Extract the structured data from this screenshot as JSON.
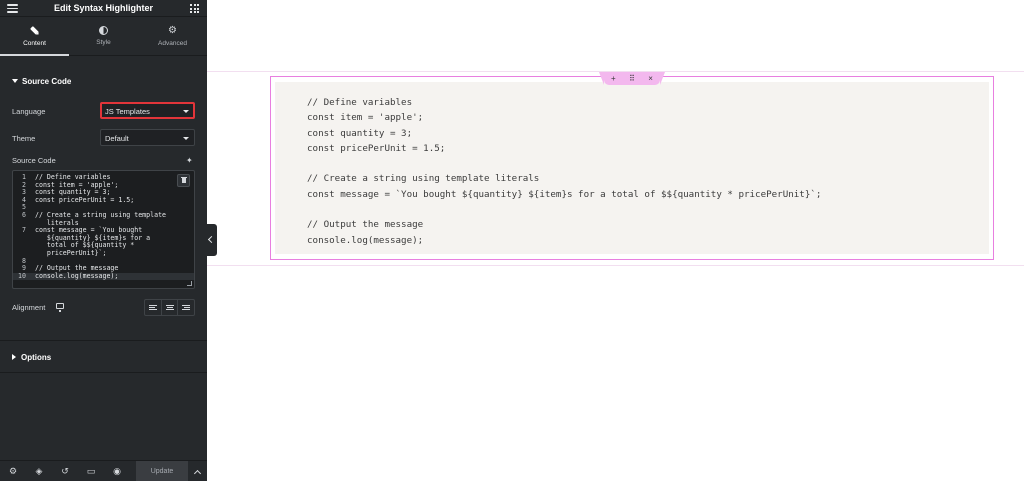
{
  "panel": {
    "title": "Edit Syntax Highlighter",
    "tabs": [
      {
        "label": "Content",
        "icon": "pencil-icon",
        "active": true
      },
      {
        "label": "Style",
        "icon": "half-circle-icon",
        "active": false
      },
      {
        "label": "Advanced",
        "icon": "gear-icon",
        "active": false
      }
    ],
    "section_source": "Source Code",
    "language_label": "Language",
    "language_value": "JS Templates",
    "theme_label": "Theme",
    "theme_value": "Default",
    "source_code_label": "Source Code",
    "code_lines": [
      {
        "n": "1",
        "text": "// Define variables"
      },
      {
        "n": "2",
        "text": "const item = 'apple';"
      },
      {
        "n": "3",
        "text": "const quantity = 3;"
      },
      {
        "n": "4",
        "text": "const pricePerUnit = 1.5;"
      },
      {
        "n": "5",
        "text": ""
      },
      {
        "n": "6",
        "text": "// Create a string using template"
      },
      {
        "n": "",
        "text": "   literals"
      },
      {
        "n": "7",
        "text": "const message = `You bought"
      },
      {
        "n": "",
        "text": "   ${quantity} ${item}s for a"
      },
      {
        "n": "",
        "text": "   total of $${quantity *"
      },
      {
        "n": "",
        "text": "   pricePerUnit}`;"
      },
      {
        "n": "8",
        "text": ""
      },
      {
        "n": "9",
        "text": "// Output the message"
      },
      {
        "n": "10",
        "text": "console.log(message);"
      }
    ],
    "alignment_label": "Alignment",
    "section_options": "Options",
    "footer": {
      "update_label": "Update"
    }
  },
  "preview": {
    "code_lines": [
      "// Define variables",
      "const item = 'apple';",
      "const quantity = 3;",
      "const pricePerUnit = 1.5;",
      "",
      "// Create a string using template literals",
      "const message = `You bought ${quantity} ${item}s for a total of $${quantity * pricePerUnit}`;",
      "",
      "// Output the message",
      "console.log(message);"
    ],
    "toolbar": {
      "add": "+",
      "move": "⠿",
      "close": "×"
    }
  },
  "colors": {
    "panel_bg": "#26292c",
    "highlight_border": "#e2353a",
    "widget_border": "#e87fe0",
    "widget_bg": "#f5f3f0"
  }
}
